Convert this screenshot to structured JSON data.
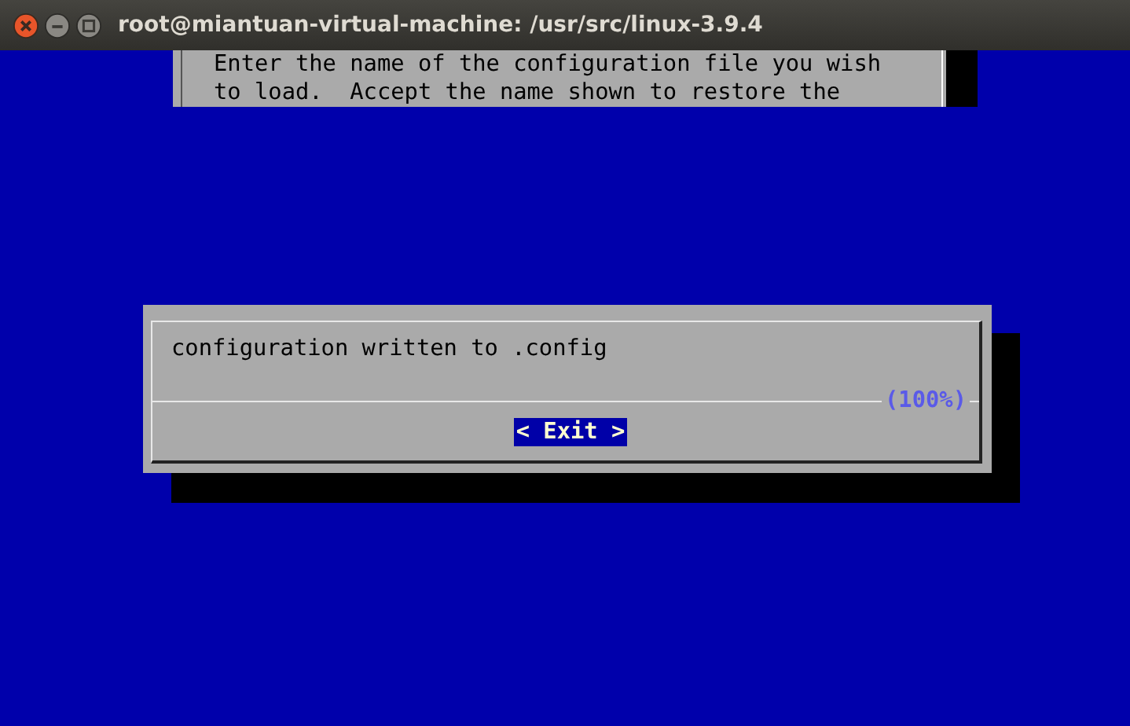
{
  "window": {
    "title": "root@miantuan-virtual-machine: /usr/src/linux-3.9.4"
  },
  "background_dialog": {
    "lines": [
      "Enter the name of the configuration file you wish",
      "to load.  Accept the name shown to restore the"
    ]
  },
  "dialog": {
    "message": "configuration written to .config",
    "progress": "(100%)",
    "buttons": [
      {
        "label": "< Exit >",
        "selected": true
      }
    ]
  }
}
